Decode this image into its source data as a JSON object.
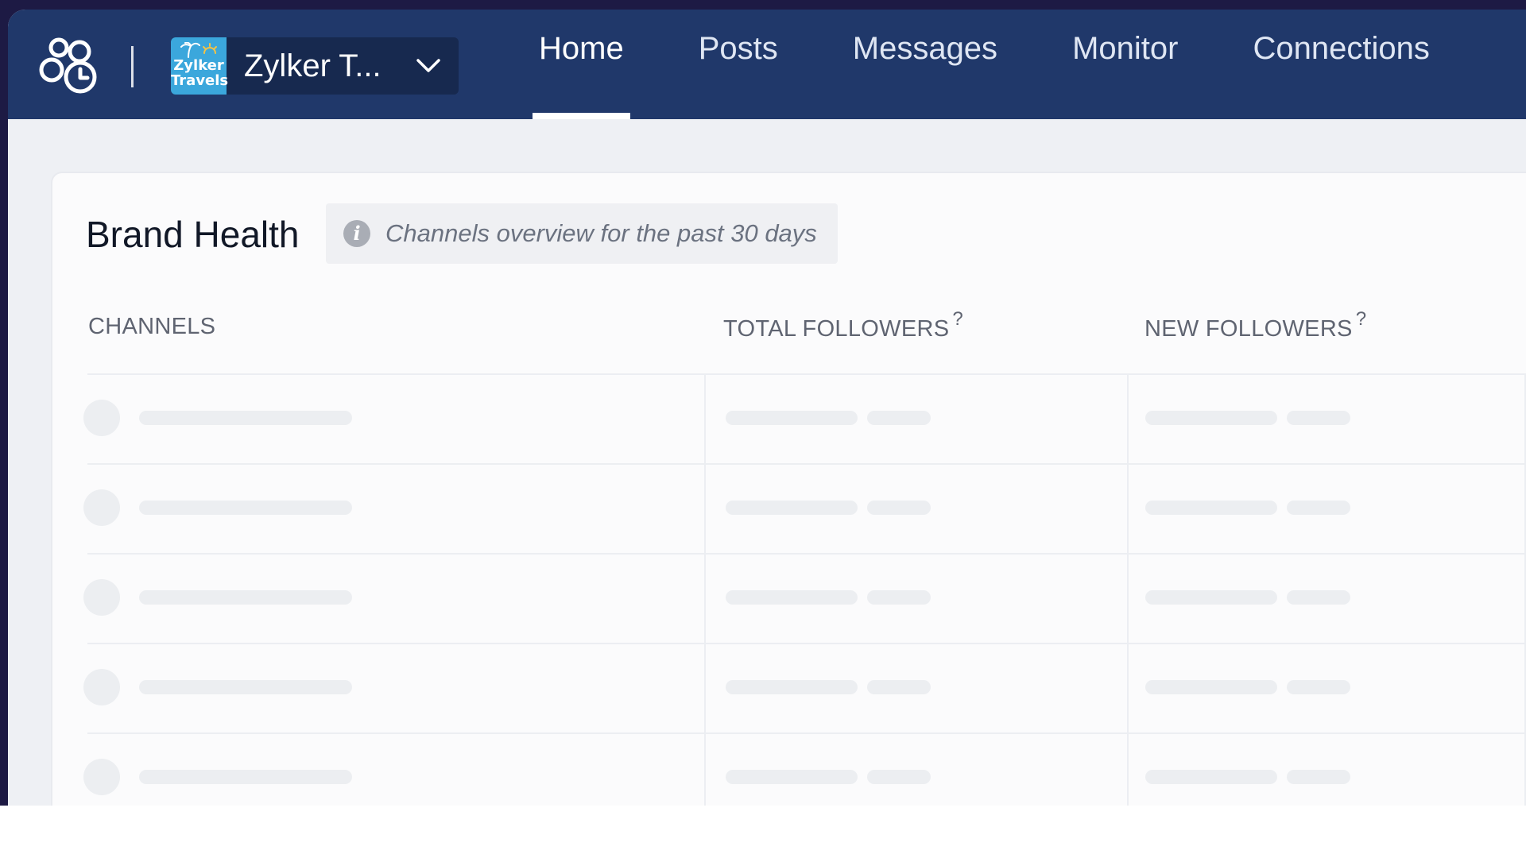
{
  "header": {
    "brand": {
      "avatar_line1": "Zylker",
      "avatar_line2": "Travels",
      "name": "Zylker T..."
    },
    "nav": [
      {
        "label": "Home",
        "active": true
      },
      {
        "label": "Posts",
        "active": false
      },
      {
        "label": "Messages",
        "active": false
      },
      {
        "label": "Monitor",
        "active": false
      },
      {
        "label": "Connections",
        "active": false
      }
    ]
  },
  "card": {
    "title": "Brand Health",
    "info": "Channels overview for the past 30 days",
    "columns": {
      "channels": "CHANNELS",
      "total_followers": "TOTAL FOLLOWERS",
      "new_followers": "NEW FOLLOWERS",
      "help_mark": "?"
    },
    "loading_rows": 5
  },
  "colors": {
    "topbar": "#20386a",
    "brand_switcher": "#17294f",
    "brand_avatar": "#3ba7dc",
    "skeleton": "#eceef1"
  }
}
